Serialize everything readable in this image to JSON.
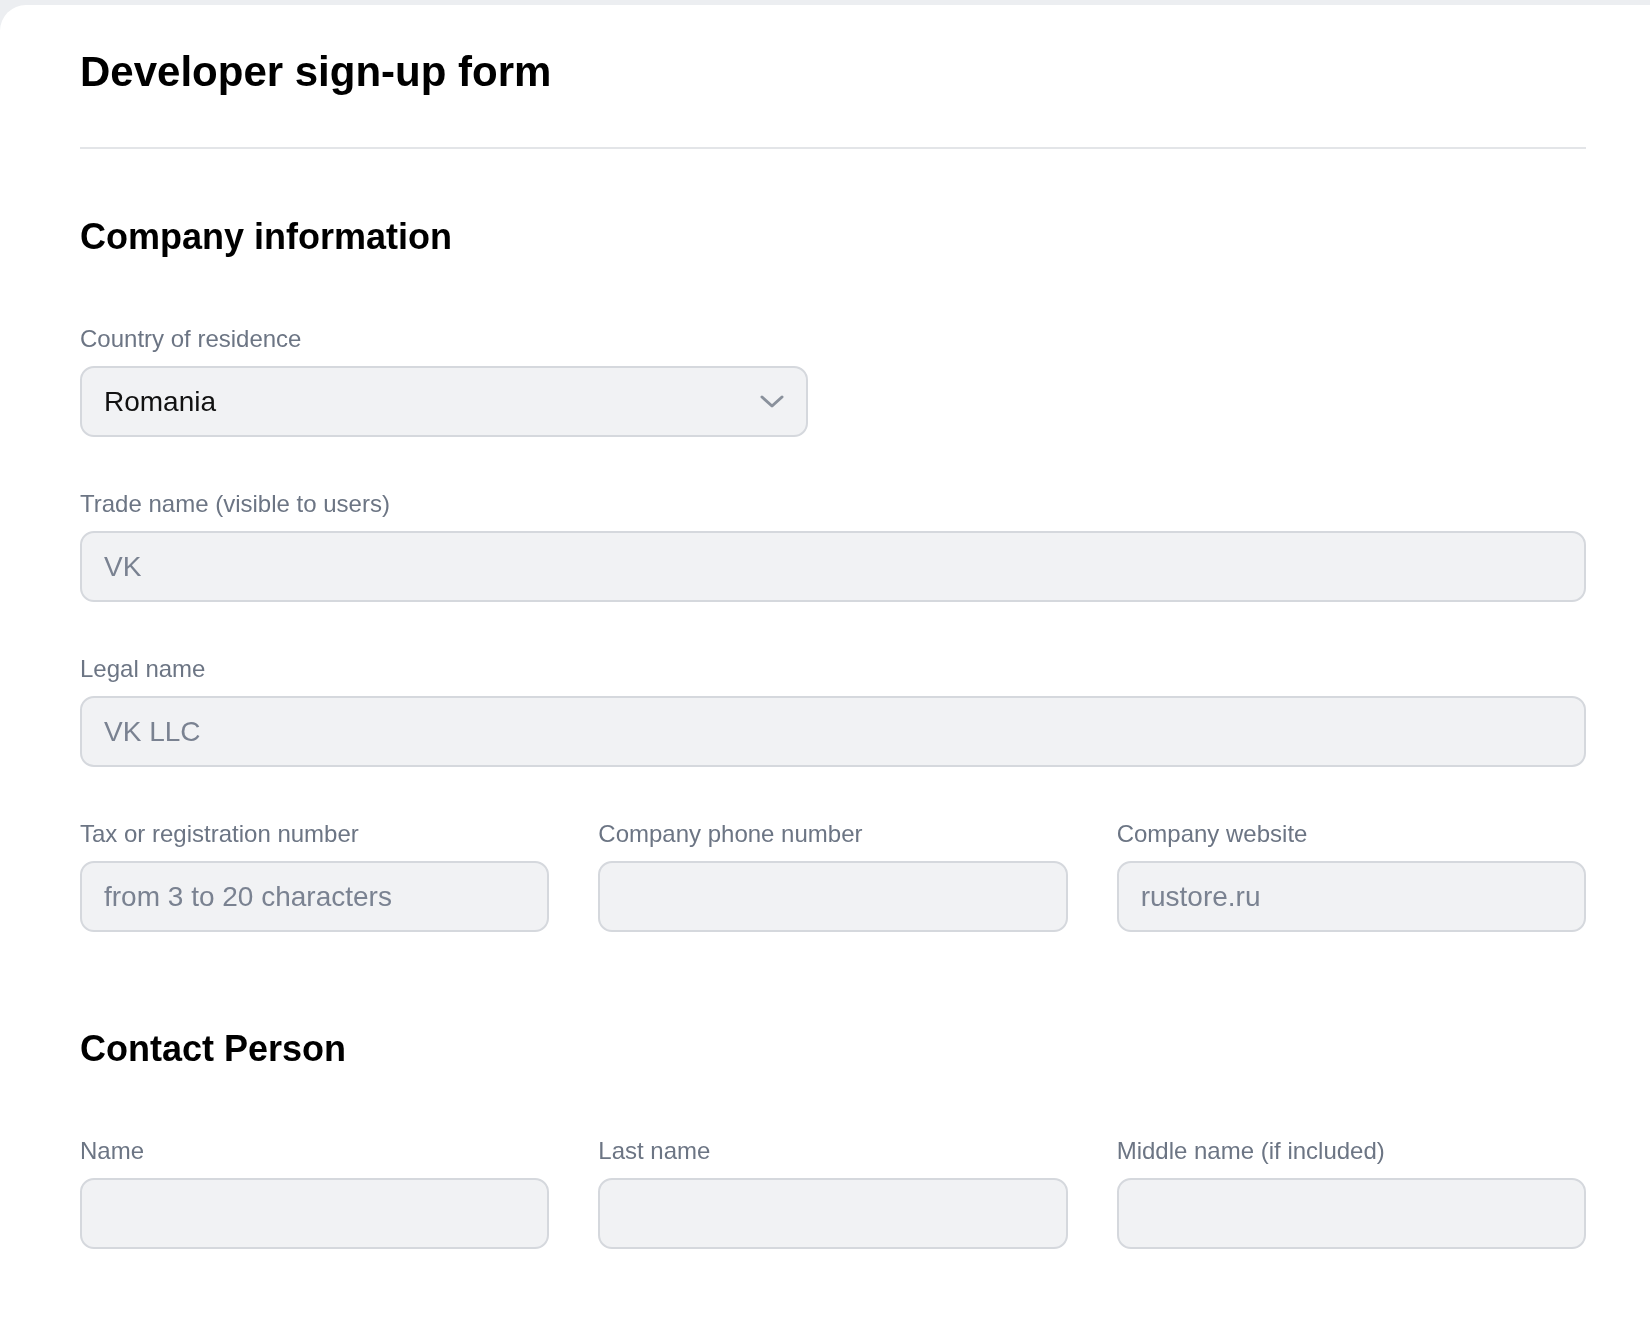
{
  "title": "Developer sign-up form",
  "sections": [
    {
      "heading": "Company information",
      "rows": [
        [
          {
            "kind": "select",
            "label": "Country of residence",
            "value": "Romania"
          }
        ],
        [
          {
            "kind": "input",
            "label": "Trade name (visible to users)",
            "placeholder": "VK"
          }
        ],
        [
          {
            "kind": "input",
            "label": "Legal name",
            "placeholder": "VK LLC"
          }
        ],
        [
          {
            "kind": "input",
            "label": "Tax or registration number",
            "placeholder": "from 3 to 20 characters"
          },
          {
            "kind": "input",
            "label": "Company phone number"
          },
          {
            "kind": "input",
            "label": "Company website",
            "placeholder": "rustore.ru"
          }
        ]
      ]
    },
    {
      "heading": "Contact Person",
      "rows": [
        [
          {
            "kind": "input",
            "label": "Name"
          },
          {
            "kind": "input",
            "label": "Last name"
          },
          {
            "kind": "input",
            "label": "Middle name (if included)"
          }
        ]
      ]
    }
  ]
}
